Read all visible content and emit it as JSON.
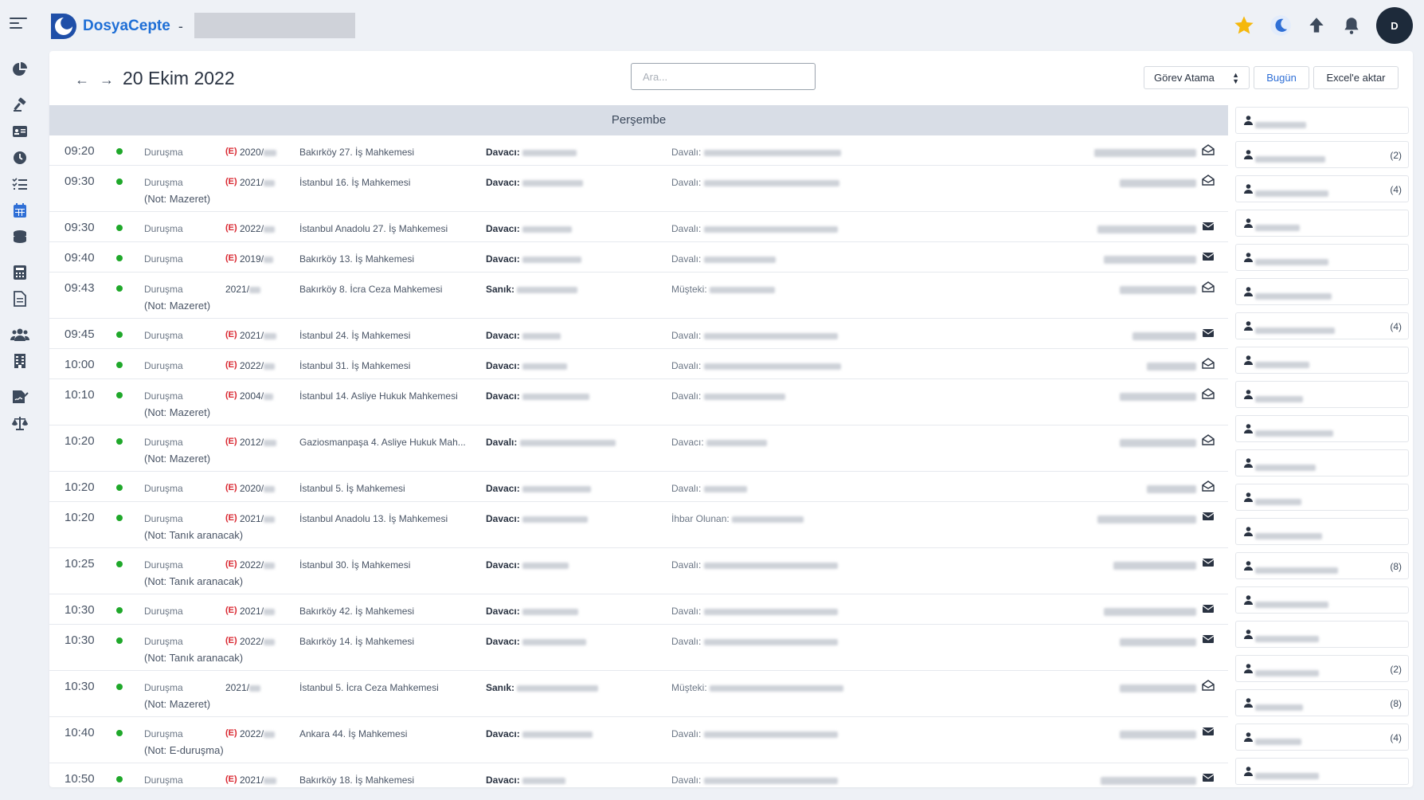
{
  "app": {
    "name": "DosyaCepte",
    "separator": "-"
  },
  "header": {
    "date": "20 Ekim 2022",
    "search_placeholder": "Ara...",
    "task_select": "Görev Atama",
    "today_button": "Bugün",
    "excel_button": "Excel'e aktar"
  },
  "user": {
    "initial": "D"
  },
  "colors": {
    "brand": "#1f6fd6",
    "status_dot": "#1fa82a",
    "e_badge": "#d9262f",
    "star": "#f5b80c"
  },
  "sidebar": {
    "icons": [
      "chart-pie-icon",
      "gavel-icon",
      "id-card-icon",
      "clock-icon",
      "task-list-icon",
      "calendar-icon",
      "coins-icon",
      "calculator-icon",
      "document-icon",
      "users-icon",
      "building-icon",
      "signature-icon",
      "scales-icon"
    ]
  },
  "calendar": {
    "day": "Perşembe",
    "rows": [
      {
        "time": "09:20",
        "type": "Duruşma",
        "note": "",
        "e": true,
        "case_no": "2020/",
        "court": "Bakırköy 27. İş Mahkemesi",
        "party_label": "Davacı:",
        "other_label": "Davalı:",
        "mail": "open"
      },
      {
        "time": "09:30",
        "type": "Duruşma",
        "note": "(Not: Mazeret)",
        "e": true,
        "case_no": "2021/",
        "court": "İstanbul 16. İş Mahkemesi",
        "party_label": "Davacı:",
        "other_label": "Davalı:",
        "mail": "open"
      },
      {
        "time": "09:30",
        "type": "Duruşma",
        "note": "",
        "e": true,
        "case_no": "2022/",
        "court": "İstanbul Anadolu 27. İş Mahkemesi",
        "party_label": "Davacı:",
        "other_label": "Davalı:",
        "mail": "closed"
      },
      {
        "time": "09:40",
        "type": "Duruşma",
        "note": "",
        "e": true,
        "case_no": "2019/",
        "court": "Bakırköy 13. İş Mahkemesi",
        "party_label": "Davacı:",
        "other_label": "Davalı:",
        "mail": "closed"
      },
      {
        "time": "09:43",
        "type": "Duruşma",
        "note": "(Not: Mazeret)",
        "e": false,
        "case_no": "2021/",
        "court": "Bakırköy 8. İcra Ceza Mahkemesi",
        "party_label": "Sanık:",
        "other_label": "Müşteki:",
        "mail": "open"
      },
      {
        "time": "09:45",
        "type": "Duruşma",
        "note": "",
        "e": true,
        "case_no": "2021/",
        "court": "İstanbul 24. İş Mahkemesi",
        "party_label": "Davacı:",
        "other_label": "Davalı:",
        "mail": "closed"
      },
      {
        "time": "10:00",
        "type": "Duruşma",
        "note": "",
        "e": true,
        "case_no": "2022/",
        "court": "İstanbul 31. İş Mahkemesi",
        "party_label": "Davacı:",
        "other_label": "Davalı:",
        "mail": "open"
      },
      {
        "time": "10:10",
        "type": "Duruşma",
        "note": "(Not: Mazeret)",
        "e": true,
        "case_no": "2004/",
        "court": "İstanbul 14. Asliye Hukuk Mahkemesi",
        "party_label": "Davacı:",
        "other_label": "Davalı:",
        "mail": "open"
      },
      {
        "time": "10:20",
        "type": "Duruşma",
        "note": "(Not: Mazeret)",
        "e": true,
        "case_no": "2012/",
        "court": "Gaziosmanpaşa 4. Asliye Hukuk Mah...",
        "party_label": "Davalı:",
        "other_label": "Davacı:",
        "mail": "open"
      },
      {
        "time": "10:20",
        "type": "Duruşma",
        "note": "",
        "e": true,
        "case_no": "2020/",
        "court": "İstanbul 5. İş Mahkemesi",
        "party_label": "Davacı:",
        "other_label": "Davalı:",
        "mail": "open"
      },
      {
        "time": "10:20",
        "type": "Duruşma",
        "note": "(Not: Tanık aranacak)",
        "e": true,
        "case_no": "2021/",
        "court": "İstanbul Anadolu 13. İş Mahkemesi",
        "party_label": "Davacı:",
        "other_label": "İhbar Olunan:",
        "mail": "closed"
      },
      {
        "time": "10:25",
        "type": "Duruşma",
        "note": "(Not: Tanık aranacak)",
        "e": true,
        "case_no": "2022/",
        "court": "İstanbul 30. İş Mahkemesi",
        "party_label": "Davacı:",
        "other_label": "Davalı:",
        "mail": "closed"
      },
      {
        "time": "10:30",
        "type": "Duruşma",
        "note": "",
        "e": true,
        "case_no": "2021/",
        "court": "Bakırköy 42. İş Mahkemesi",
        "party_label": "Davacı:",
        "other_label": "Davalı:",
        "mail": "closed"
      },
      {
        "time": "10:30",
        "type": "Duruşma",
        "note": "(Not: Tanık aranacak)",
        "e": true,
        "case_no": "2022/",
        "court": "Bakırköy 14. İş Mahkemesi",
        "party_label": "Davacı:",
        "other_label": "Davalı:",
        "mail": "closed"
      },
      {
        "time": "10:30",
        "type": "Duruşma",
        "note": "(Not: Mazeret)",
        "e": false,
        "case_no": "2021/",
        "court": "İstanbul 5. İcra Ceza Mahkemesi",
        "party_label": "Sanık:",
        "other_label": "Müşteki:",
        "mail": "open"
      },
      {
        "time": "10:40",
        "type": "Duruşma",
        "note": "(Not: E-duruşma)",
        "e": true,
        "case_no": "2022/",
        "court": "Ankara 44. İş Mahkemesi",
        "party_label": "Davacı:",
        "other_label": "Davalı:",
        "mail": "closed"
      },
      {
        "time": "10:50",
        "type": "Duruşma",
        "note": "",
        "e": true,
        "case_no": "2021/",
        "court": "Bakırköy 18. İş Mahkemesi",
        "party_label": "Davacı:",
        "other_label": "Davalı:",
        "mail": "closed"
      }
    ]
  },
  "people": [
    {
      "count": ""
    },
    {
      "count": "(2)"
    },
    {
      "count": "(4)"
    },
    {
      "count": ""
    },
    {
      "count": ""
    },
    {
      "count": ""
    },
    {
      "count": "(4)"
    },
    {
      "count": ""
    },
    {
      "count": ""
    },
    {
      "count": ""
    },
    {
      "count": ""
    },
    {
      "count": ""
    },
    {
      "count": ""
    },
    {
      "count": "(8)"
    },
    {
      "count": ""
    },
    {
      "count": ""
    },
    {
      "count": "(2)"
    },
    {
      "count": "(8)"
    },
    {
      "count": "(4)"
    },
    {
      "count": ""
    }
  ]
}
